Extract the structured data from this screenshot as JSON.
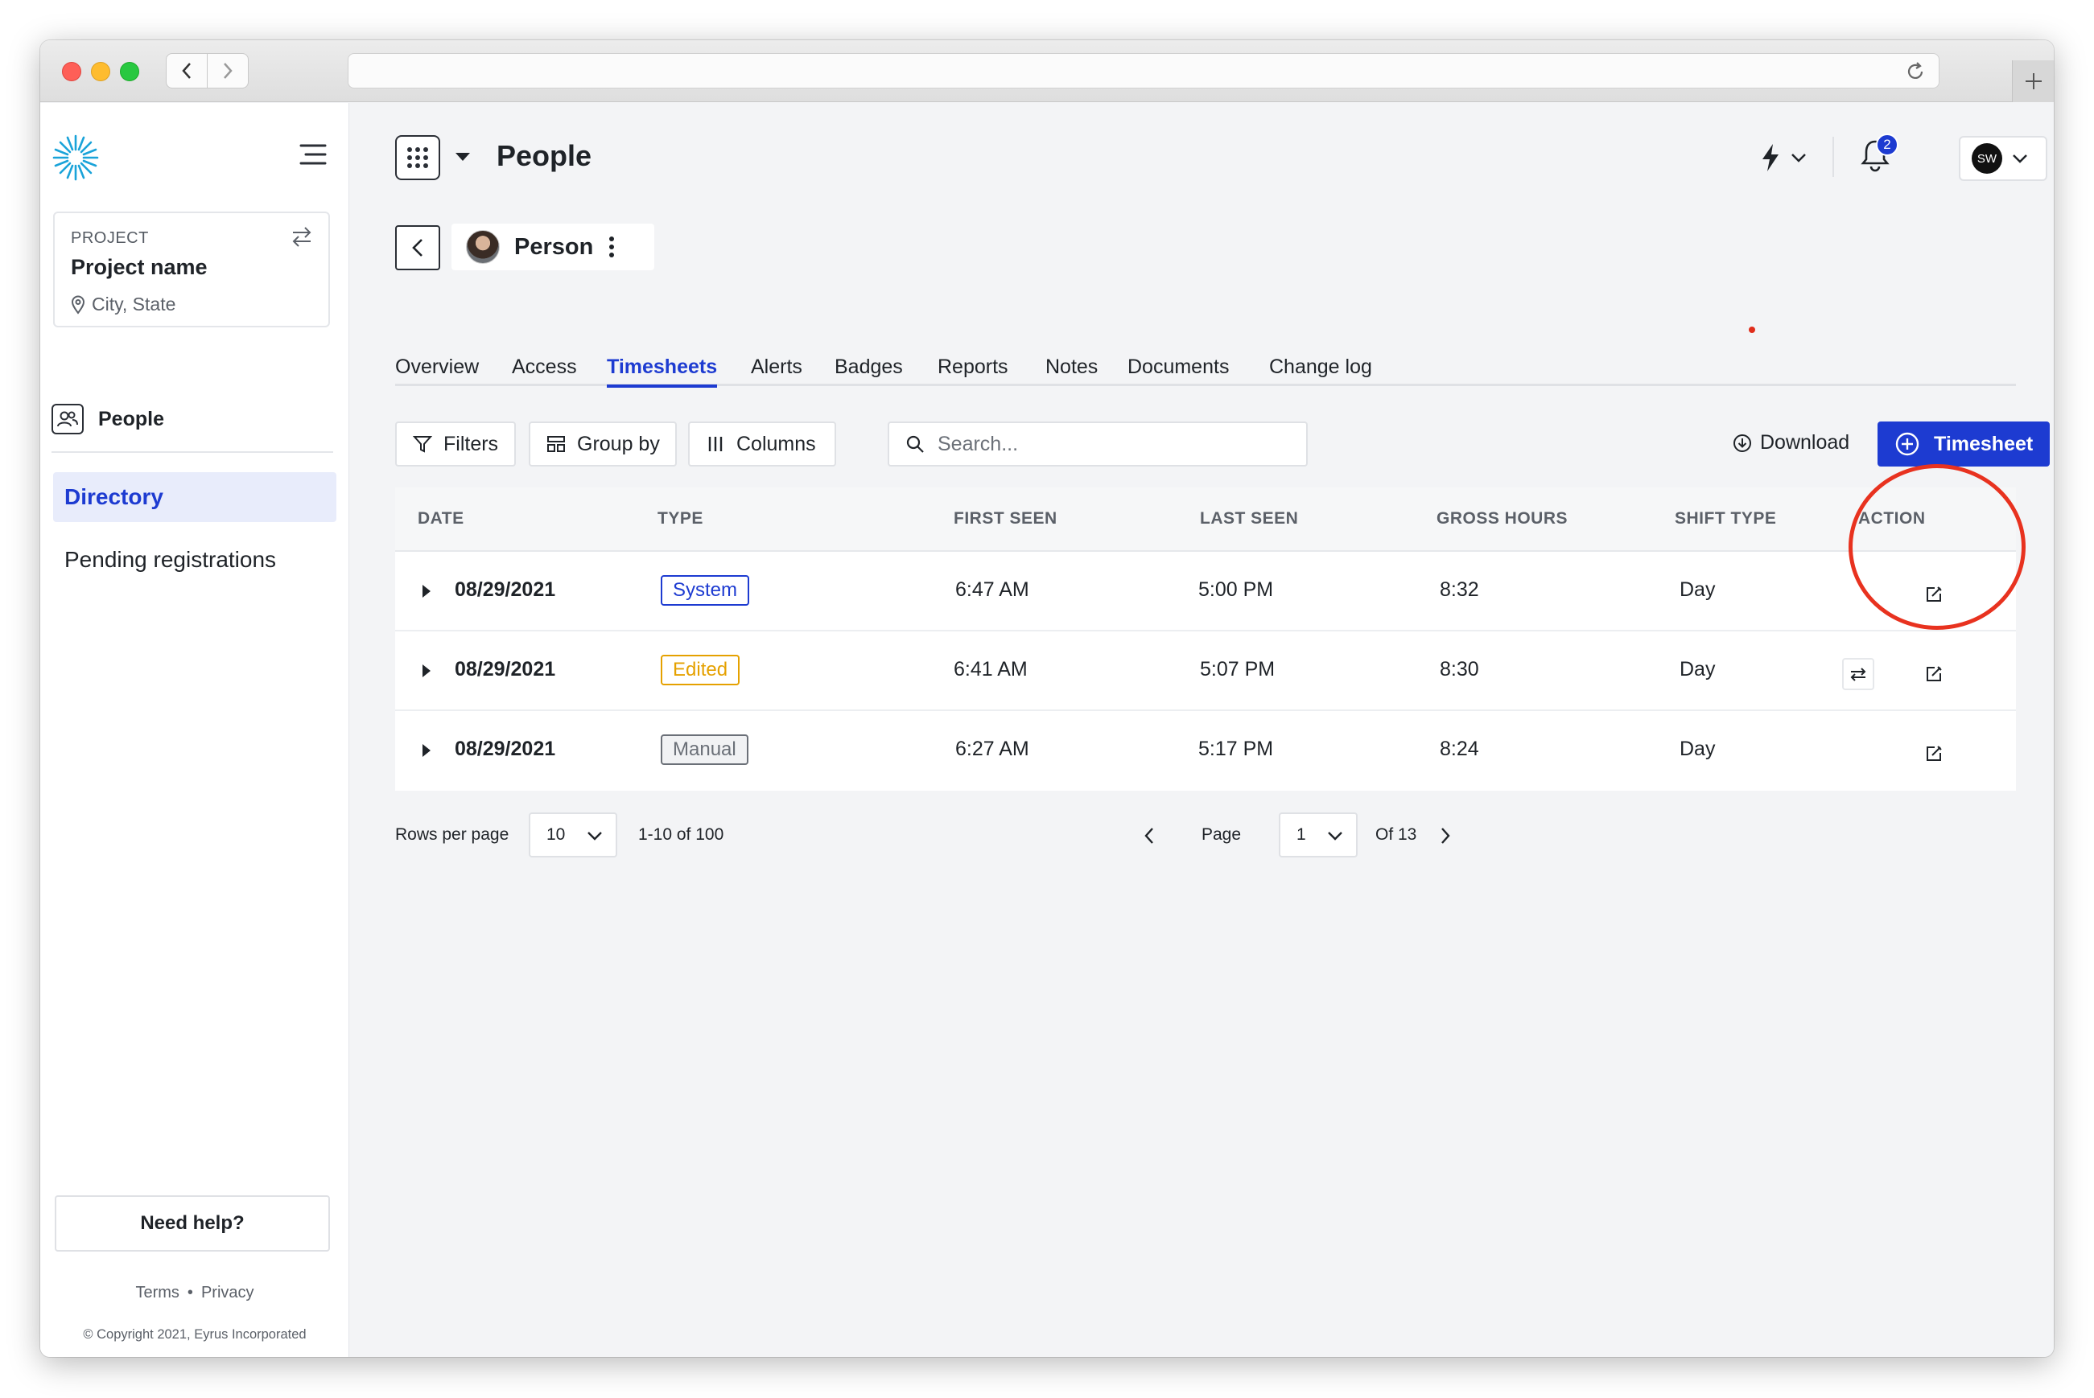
{
  "colors": {
    "accent": "#1d3bd1",
    "system": "#1d3bd1",
    "edited": "#e5a100",
    "manual": "#6b7078",
    "annotation": "#e8321f"
  },
  "sidebar": {
    "project_label": "PROJECT",
    "project_name": "Project name",
    "project_location": "City, State",
    "section": "People",
    "items": [
      {
        "label": "Directory",
        "active": true
      },
      {
        "label": "Pending registrations",
        "active": false
      }
    ],
    "help_label": "Need help?",
    "terms": "Terms",
    "privacy": "Privacy",
    "copyright": "© Copyright 2021, Eyrus Incorporated"
  },
  "header": {
    "title": "People",
    "notification_count": "2",
    "user_initials": "SW"
  },
  "person": {
    "name": "Person"
  },
  "tabs": [
    {
      "label": "Overview"
    },
    {
      "label": "Access"
    },
    {
      "label": "Timesheets",
      "active": true
    },
    {
      "label": "Alerts"
    },
    {
      "label": "Badges"
    },
    {
      "label": "Reports"
    },
    {
      "label": "Notes"
    },
    {
      "label": "Documents"
    },
    {
      "label": "Change log"
    }
  ],
  "toolbar": {
    "filters": "Filters",
    "group_by": "Group by",
    "columns": "Columns",
    "search_placeholder": "Search...",
    "download": "Download",
    "add_timesheet": "Timesheet"
  },
  "table": {
    "headers": [
      "DATE",
      "TYPE",
      "FIRST SEEN",
      "LAST SEEN",
      "GROSS HOURS",
      "SHIFT TYPE",
      "ACTION"
    ],
    "rows": [
      {
        "date": "08/29/2021",
        "type": "System",
        "first_seen": "6:47 AM",
        "last_seen": "5:00 PM",
        "gross_hours": "8:32",
        "shift_type": "Day"
      },
      {
        "date": "08/29/2021",
        "type": "Edited",
        "first_seen": "6:41 AM",
        "last_seen": "5:07 PM",
        "gross_hours": "8:30",
        "shift_type": "Day"
      },
      {
        "date": "08/29/2021",
        "type": "Manual",
        "first_seen": "6:27 AM",
        "last_seen": "5:17 PM",
        "gross_hours": "8:24",
        "shift_type": "Day"
      }
    ]
  },
  "pagination": {
    "rows_per_page_label": "Rows per page",
    "rows_per_page": "10",
    "range": "1-10 of 100",
    "page_label": "Page",
    "page": "1",
    "of_pages": "Of 13"
  }
}
